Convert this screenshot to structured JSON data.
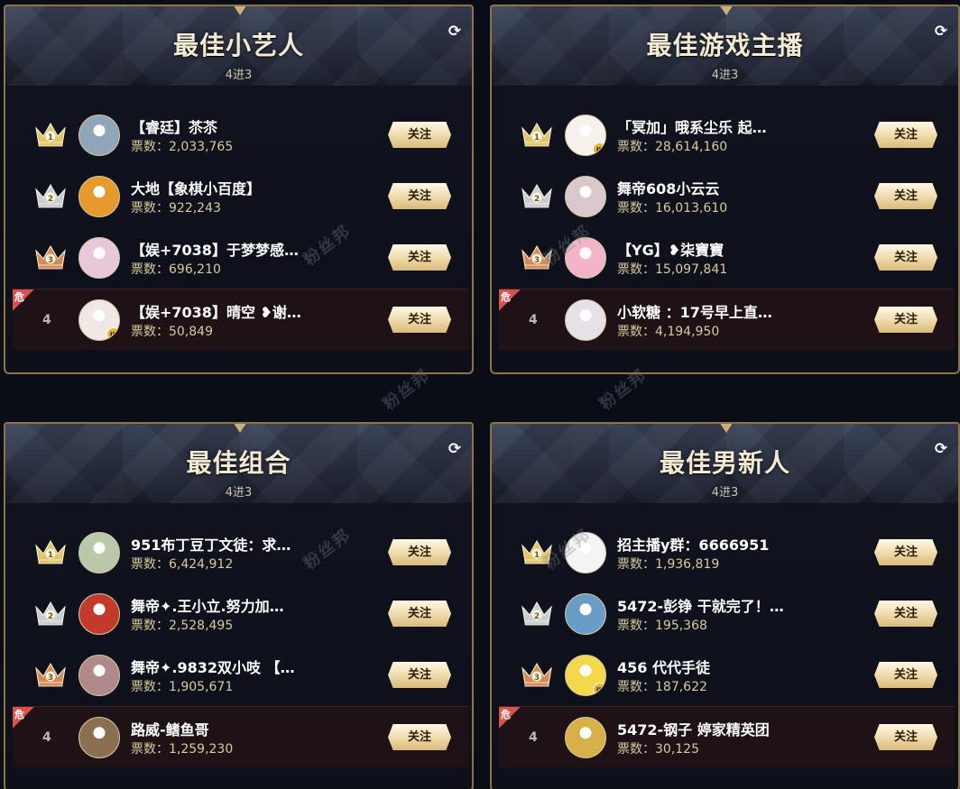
{
  "watermark_text": "粉丝邦",
  "follow_label": "关注",
  "votes_prefix": "票数：",
  "danger_label": "危",
  "refresh_icon": "refresh-icon",
  "colors": {
    "gold": "#c9b07a",
    "crown_gold": "#e0c56a",
    "crown_silver": "#c8ccd8",
    "crown_bronze": "#d48a5a",
    "danger": "#d8514a"
  },
  "panels": [
    {
      "title": "最佳小艺人",
      "subtitle": "4进3",
      "rows": [
        {
          "rank": "1",
          "name": "【睿廷】苶苶",
          "votes": "2,033,765"
        },
        {
          "rank": "2",
          "name": "大地【象棋小百度】",
          "votes": "922,243"
        },
        {
          "rank": "3",
          "name": "【娱+7038】于梦梦感…",
          "votes": "696,210"
        },
        {
          "rank": "4",
          "name": "【娱+7038】晴空 ❥谢…",
          "votes": "50,849"
        }
      ]
    },
    {
      "title": "最佳游戏主播",
      "subtitle": "4进3",
      "rows": [
        {
          "rank": "1",
          "name": "「冥加」哦系尘乐 起…",
          "votes": "28,614,160"
        },
        {
          "rank": "2",
          "name": "舞帝608小云云",
          "votes": "16,013,610"
        },
        {
          "rank": "3",
          "name": "【YG】❥柒寶寶",
          "votes": "15,097,841"
        },
        {
          "rank": "4",
          "name": "小软糖 ：17号早上直…",
          "votes": "4,194,950"
        }
      ]
    },
    {
      "title": "最佳组合",
      "subtitle": "4进3",
      "rows": [
        {
          "rank": "1",
          "name": "951布丁豆丁文徒：求…",
          "votes": "6,424,912"
        },
        {
          "rank": "2",
          "name": "舞帝✦.王小立.努力加…",
          "votes": "2,528,495"
        },
        {
          "rank": "3",
          "name": "舞帝✦.9832双小吱 【…",
          "votes": "1,905,671"
        },
        {
          "rank": "4",
          "name": "路威-鳍鱼哥",
          "votes": "1,259,230"
        }
      ]
    },
    {
      "title": "最佳男新人",
      "subtitle": "4进3",
      "rows": [
        {
          "rank": "1",
          "name": "招主播y群：6666951",
          "votes": "1,936,819"
        },
        {
          "rank": "2",
          "name": "5472-彭铮 干就完了！…",
          "votes": "195,368"
        },
        {
          "rank": "3",
          "name": "456 代代手徒",
          "votes": "187,622"
        },
        {
          "rank": "4",
          "name": "5472-钢子 婷家精英团",
          "votes": "30,125"
        }
      ]
    }
  ]
}
